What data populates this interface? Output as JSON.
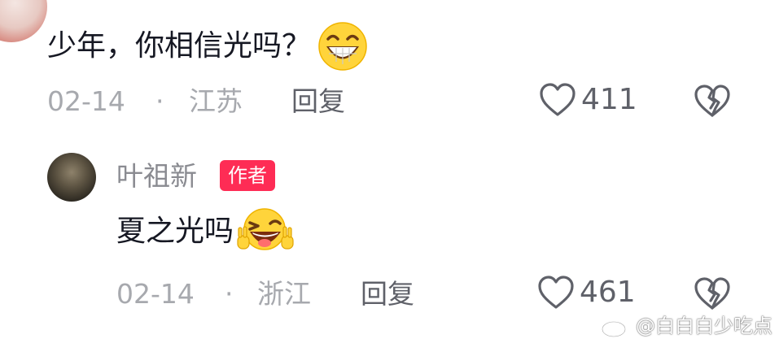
{
  "comment": {
    "text": "少年，你相信光吗？",
    "emoji": "grinning-teeth-emoji",
    "date": "02-14",
    "separator": "·",
    "location": "江苏",
    "reply_label": "回复",
    "like_count": "411"
  },
  "reply": {
    "username": "叶祖新",
    "badge": "作者",
    "text": "夏之光吗",
    "emoji": "laughing-wink-emoji",
    "date": "02-14",
    "separator": "·",
    "location": "浙江",
    "reply_label": "回复",
    "like_count": "461"
  },
  "watermark": {
    "text": "@白白白少吃点"
  },
  "colors": {
    "text_primary": "#161823",
    "text_meta": "#a7a9ae",
    "text_secondary": "#5f6169",
    "badge_bg": "#fe2c55",
    "icon": "#5f6169"
  },
  "icons": [
    "heart-outline-icon",
    "broken-heart-icon",
    "weibo-logo-icon"
  ]
}
